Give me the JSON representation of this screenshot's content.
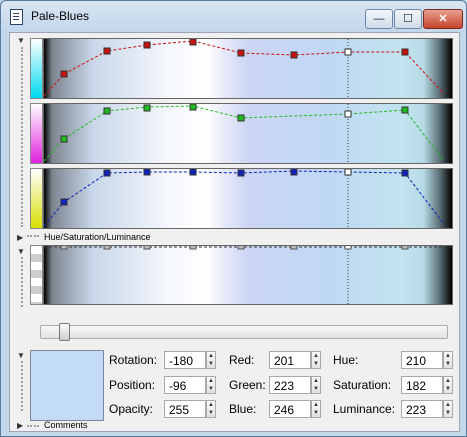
{
  "window": {
    "title": "Pale-Blues",
    "min_label": "—",
    "max_label": "☐",
    "close_label": "✕"
  },
  "curves": {
    "red_color": "#cc1111",
    "green_color": "#22bb22",
    "blue_color": "#1122bb"
  },
  "sections": {
    "hsl_label": "Hue/Saturation/Luminance",
    "comments_label": "Comments"
  },
  "color": {
    "swatch": "#c4dbf6"
  },
  "fields": {
    "rotation": {
      "label": "Rotation:",
      "value": "-180"
    },
    "position": {
      "label": "Position:",
      "value": "-96"
    },
    "opacity": {
      "label": "Opacity:",
      "value": "255"
    },
    "red": {
      "label": "Red:",
      "value": "201"
    },
    "green": {
      "label": "Green:",
      "value": "223"
    },
    "blue": {
      "label": "Blue:",
      "value": "246"
    },
    "hue": {
      "label": "Hue:",
      "value": "210"
    },
    "saturation": {
      "label": "Saturation:",
      "value": "182"
    },
    "luminance": {
      "label": "Luminance:",
      "value": "223"
    }
  }
}
